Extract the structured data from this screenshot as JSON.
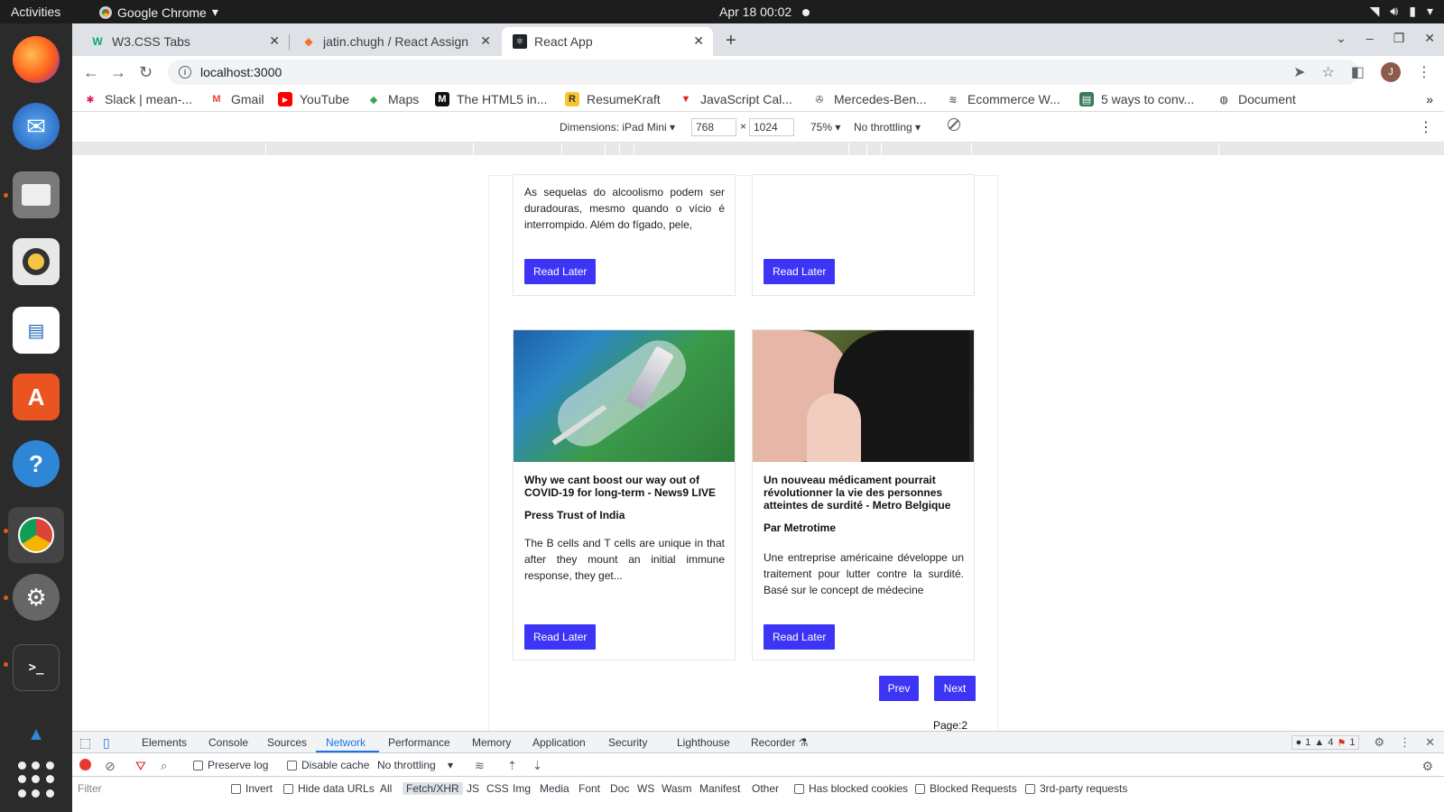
{
  "os": {
    "activities": "Activities",
    "app_name": "Google Chrome",
    "clock": "Apr 18  00:02"
  },
  "browser": {
    "tabs": [
      {
        "title": "W3.CSS Tabs",
        "active": false
      },
      {
        "title": "jatin.chugh / React Assign",
        "active": false
      },
      {
        "title": "React App",
        "active": true
      }
    ],
    "url": "localhost:3000",
    "avatar_initial": "J",
    "bookmarks": [
      "Slack | mean-...",
      "Gmail",
      "YouTube",
      "Maps",
      "The HTML5 in...",
      "ResumeKraft",
      "JavaScript Cal...",
      "Mercedes-Ben...",
      "Ecommerce W...",
      "5 ways to conv...",
      "Document"
    ]
  },
  "device_toolbar": {
    "dimensions_label": "Dimensions: iPad Mini",
    "width": "768",
    "height": "1024",
    "times": "×",
    "zoom": "75%",
    "throttling": "No throttling"
  },
  "app": {
    "cards": [
      {
        "title": "",
        "author": "",
        "description": "As sequelas do alcoolismo podem ser duradouras, mesmo quando o vício é interrompido. Além do fígado, pele,",
        "button": "Read Later"
      },
      {
        "title": "",
        "author": "",
        "description": "",
        "button": "Read Later"
      },
      {
        "title": "Why we cant boost our way out of COVID-19 for long-term - News9 LIVE",
        "author": "Press Trust of India",
        "description": "The B cells and T cells are unique in that after they mount an initial immune response, they get...",
        "button": "Read Later"
      },
      {
        "title": "Un nouveau médicament pourrait révolutionner la vie des personnes atteintes de surdité - Metro Belgique",
        "author": "Par Metrotime",
        "description": "Une entreprise américaine développe un traitement pour lutter contre la surdité. Basé sur le concept de médecine",
        "button": "Read Later"
      }
    ],
    "prev": "Prev",
    "next": "Next",
    "page_label": "Page:2"
  },
  "devtools": {
    "tabs": [
      "Elements",
      "Console",
      "Sources",
      "Network",
      "Performance",
      "Memory",
      "Application",
      "Security",
      "Lighthouse",
      "Recorder"
    ],
    "active_tab": "Network",
    "counts": {
      "errors": "1",
      "warnings": "4",
      "issues": "1"
    },
    "preserve_log": "Preserve log",
    "disable_cache": "Disable cache",
    "throttling": "No throttling",
    "filter_placeholder": "Filter",
    "invert": "Invert",
    "hide_data_urls": "Hide data URLs",
    "types": [
      "All",
      "Fetch/XHR",
      "JS",
      "CSS",
      "Img",
      "Media",
      "Font",
      "Doc",
      "WS",
      "Wasm",
      "Manifest",
      "Other"
    ],
    "selected_type": "Fetch/XHR",
    "has_blocked_cookies": "Has blocked cookies",
    "blocked_requests": "Blocked Requests",
    "third_party": "3rd-party requests"
  }
}
